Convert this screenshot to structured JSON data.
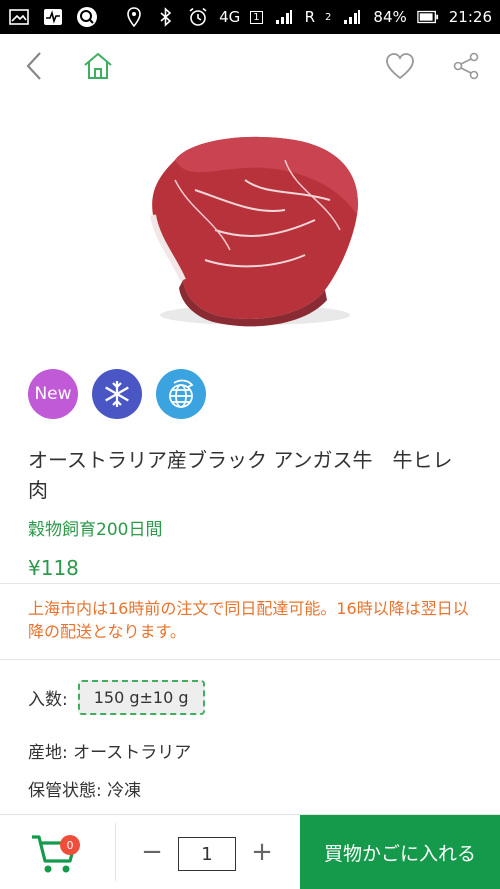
{
  "status_bar": {
    "network": "4G",
    "sim_indicator": "1",
    "roaming": "R",
    "signal_slot": "2",
    "battery": "84%",
    "time": "21:26"
  },
  "product": {
    "badges": [
      "New"
    ],
    "title": "オーストラリア産ブラック アンガス牛　牛ヒレ肉",
    "subtitle": "穀物飼育200日間",
    "price": "¥118",
    "notice": "上海市内は16時前の注文で同日配達可能。16時以降は翌日以降の配送となります。",
    "quantity_label": "入数:",
    "quantity_option": "150 g±10 g",
    "origin": "産地: オーストラリア",
    "storage": "保管状態: 冷凍"
  },
  "cart": {
    "count": "0",
    "quantity": "1",
    "minus": "−",
    "plus": "+",
    "add_button": "買物かごに入れる"
  },
  "colors": {
    "accent": "#149a4a",
    "notice": "#e8732c",
    "badge_new": "#c05ad6",
    "badge_frozen": "#4a56c4",
    "badge_import": "#3aa3e0"
  }
}
